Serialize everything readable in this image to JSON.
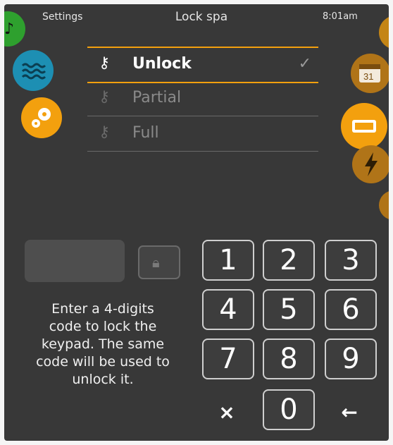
{
  "header": {
    "settings": "Settings",
    "title": "Lock spa",
    "time": "8:01am"
  },
  "options": [
    {
      "label": "Unlock",
      "selected": true
    },
    {
      "label": "Partial",
      "selected": false
    },
    {
      "label": "Full",
      "selected": false
    }
  ],
  "check_glyph": "✓",
  "instructions": "Enter a 4-digits\ncode to lock the\nkeypad. The same\ncode will be used to\nunlock it.",
  "keypad": {
    "k1": "1",
    "k2": "2",
    "k3": "3",
    "k4": "4",
    "k5": "5",
    "k6": "6",
    "k7": "7",
    "k8": "8",
    "k9": "9",
    "k0": "0",
    "clear": "×",
    "back": "←"
  },
  "calendar_label": "31",
  "colors": {
    "accent": "#f3a00e",
    "water": "#1d8fb3",
    "music": "#2ea02e",
    "background": "#383838"
  },
  "icons": [
    "music-icon",
    "water-icon",
    "gear-icon",
    "calendar-icon",
    "display-icon",
    "lightning-icon",
    "key-icon",
    "lock-icon"
  ]
}
